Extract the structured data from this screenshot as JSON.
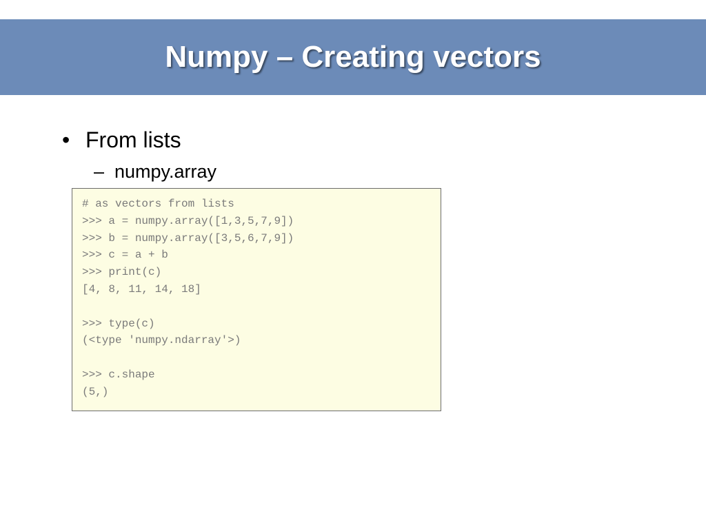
{
  "title": "Numpy – Creating vectors",
  "bullets": [
    {
      "text": "From lists",
      "children": [
        {
          "text": "numpy.array"
        }
      ]
    }
  ],
  "code": "# as vectors from lists\n>>> a = numpy.array([1,3,5,7,9])\n>>> b = numpy.array([3,5,6,7,9])\n>>> c = a + b\n>>> print(c)\n[4, 8, 11, 14, 18]\n\n>>> type(c)\n(<type 'numpy.ndarray'>)\n\n>>> c.shape\n(5,)",
  "colors": {
    "title_bar_bg": "#6c8bb8",
    "title_text": "#ffffff",
    "code_bg": "#fdfde3",
    "code_border": "#6b6b6b",
    "code_text": "#7a7a7a"
  }
}
